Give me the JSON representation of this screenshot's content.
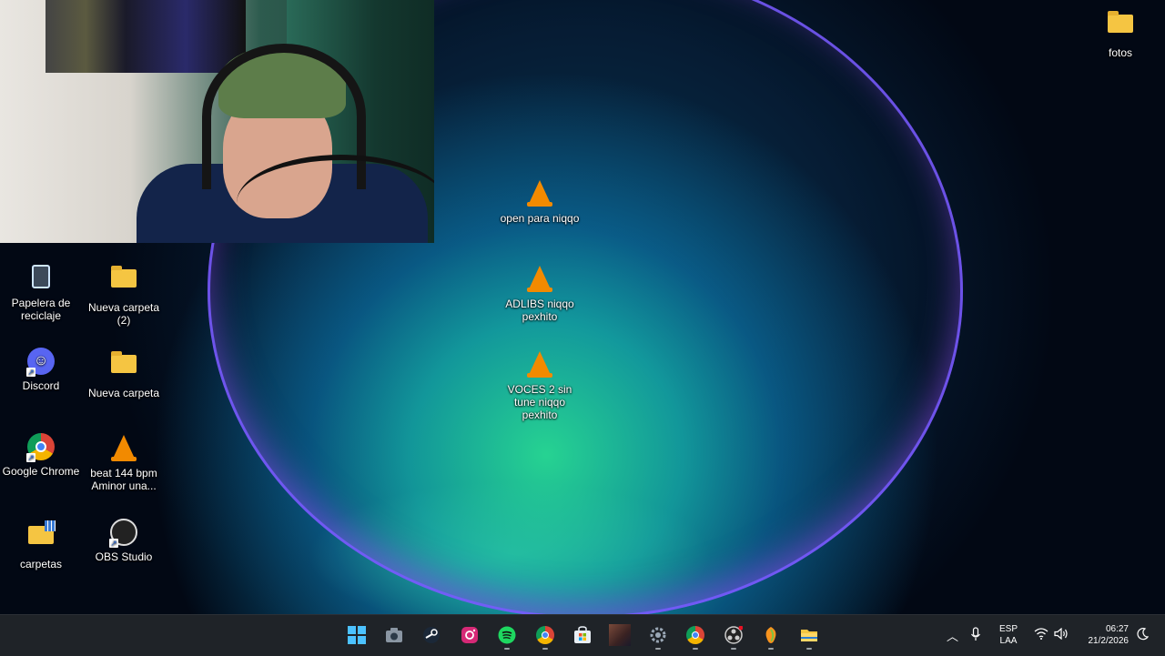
{
  "desktop": {
    "icons": [
      {
        "label": "fotos",
        "icon": "folder-icon"
      },
      {
        "label": "open para niqqo",
        "icon": "vlc-icon"
      },
      {
        "label": "ADLIBS niqqo pexhito",
        "icon": "vlc-icon"
      },
      {
        "label": "VOCES 2 sin tune niqqo pexhito",
        "icon": "vlc-icon"
      },
      {
        "label": "Papelera de reciclaje",
        "icon": "recycle-bin-icon"
      },
      {
        "label": "Nueva carpeta (2)",
        "icon": "folder-icon"
      },
      {
        "label": "Discord",
        "icon": "discord-icon"
      },
      {
        "label": "Nueva carpeta",
        "icon": "folder-icon"
      },
      {
        "label": "Google Chrome",
        "icon": "chrome-icon"
      },
      {
        "label": "beat 144 bpm Aminor una...",
        "icon": "vlc-icon"
      },
      {
        "label": "carpetas",
        "icon": "folder-icon"
      },
      {
        "label": "OBS Studio",
        "icon": "obs-icon"
      }
    ]
  },
  "taskbar": {
    "apps": [
      "windows-start-icon",
      "camera-icon",
      "steam-icon",
      "instagram-icon",
      "spotify-icon",
      "chrome-icon",
      "microsoft-store-icon",
      "game-icon",
      "settings-icon",
      "chrome-icon",
      "obs-icon",
      "fl-studio-icon",
      "file-explorer-icon"
    ],
    "language": {
      "line1": "ESP",
      "line2": "LAA"
    },
    "clock": {
      "time": "06:27",
      "date": "21/2/2026"
    }
  },
  "colors": {
    "taskbar": "#1f2328",
    "folder": "#f5c542",
    "vlc": "#f28a00",
    "discord": "#5865f2"
  }
}
